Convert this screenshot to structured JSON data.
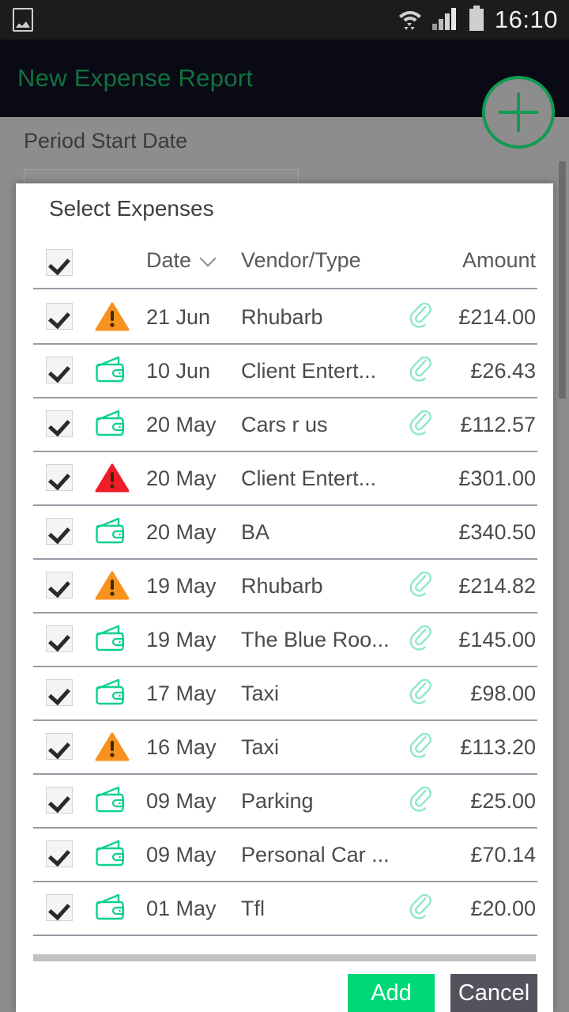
{
  "status_bar": {
    "left_icon": "image-icon",
    "wifi_icon": "wifi-icon",
    "signal_icon": "cellular-signal-icon",
    "battery_icon": "battery-icon",
    "time": "16:10"
  },
  "app_bar": {
    "title": "New Expense Report",
    "title_color": "#11723e",
    "background_color": "#0a0a16",
    "fab": {
      "name": "add-fab",
      "glyph": "+",
      "accent_color": "#119b52"
    }
  },
  "background_form": {
    "period_start_label": "Period Start Date",
    "period_start_value": "",
    "period_start_placeholder": ""
  },
  "dialog": {
    "title": "Select Expenses",
    "select_all_checked": true,
    "columns": {
      "date": "Date",
      "vendor": "Vendor/Type",
      "amount": "Amount",
      "sort_icon": "chevron-down-icon",
      "sort_column": "Date"
    },
    "rows": [
      {
        "checked": true,
        "type_icon": "warning-triangle-orange-icon",
        "date": "21 Jun",
        "vendor": "Rhubarb",
        "attachment": true,
        "amount": "£214.00"
      },
      {
        "checked": true,
        "type_icon": "wallet-icon",
        "date": "10 Jun",
        "vendor": "Client Entert...",
        "attachment": true,
        "amount": "£26.43"
      },
      {
        "checked": true,
        "type_icon": "wallet-icon",
        "date": "20 May",
        "vendor": "Cars r us",
        "attachment": true,
        "amount": "£112.57"
      },
      {
        "checked": true,
        "type_icon": "warning-triangle-red-icon",
        "date": "20 May",
        "vendor": "Client Entert...",
        "attachment": false,
        "amount": "£301.00"
      },
      {
        "checked": true,
        "type_icon": "wallet-icon",
        "date": "20 May",
        "vendor": "BA",
        "attachment": false,
        "amount": "£340.50"
      },
      {
        "checked": true,
        "type_icon": "warning-triangle-orange-icon",
        "date": "19 May",
        "vendor": "Rhubarb",
        "attachment": true,
        "amount": "£214.82"
      },
      {
        "checked": true,
        "type_icon": "wallet-icon",
        "date": "19 May",
        "vendor": "The Blue Roo...",
        "attachment": true,
        "amount": "£145.00"
      },
      {
        "checked": true,
        "type_icon": "wallet-icon",
        "date": "17 May",
        "vendor": "Taxi",
        "attachment": true,
        "amount": "£98.00"
      },
      {
        "checked": true,
        "type_icon": "warning-triangle-orange-icon",
        "date": "16 May",
        "vendor": "Taxi",
        "attachment": true,
        "amount": "£113.20"
      },
      {
        "checked": true,
        "type_icon": "wallet-icon",
        "date": "09 May",
        "vendor": "Parking",
        "attachment": true,
        "amount": "£25.00"
      },
      {
        "checked": true,
        "type_icon": "wallet-icon",
        "date": "09 May",
        "vendor": "Personal Car ...",
        "attachment": false,
        "amount": "£70.14"
      },
      {
        "checked": true,
        "type_icon": "wallet-icon",
        "date": "01 May",
        "vendor": "Tfl",
        "attachment": true,
        "amount": "£20.00"
      }
    ],
    "add_label": "Add",
    "cancel_label": "Cancel",
    "add_color": "#00d878",
    "cancel_color": "#53535e"
  }
}
